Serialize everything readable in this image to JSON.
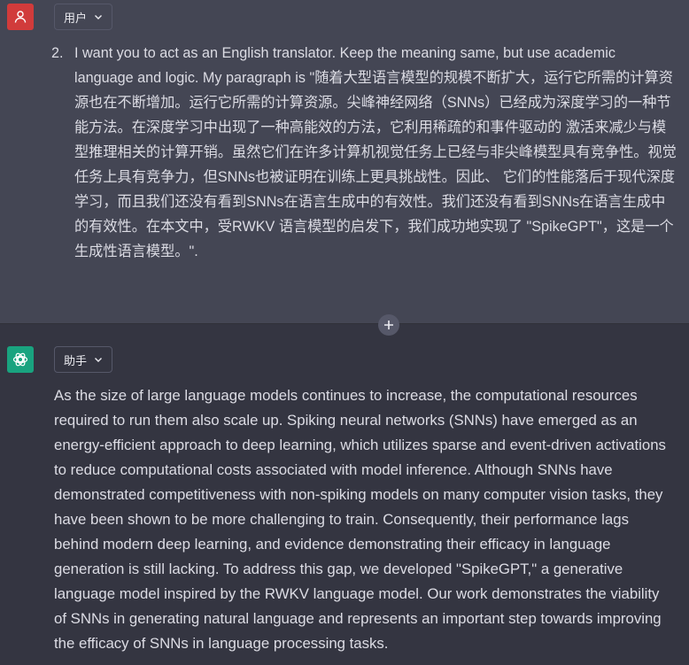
{
  "colors": {
    "user_bg": "#444654",
    "assistant_bg": "#343541",
    "user_avatar": "#d13b3b",
    "assistant_avatar": "#19a37f",
    "text": "#dcdce4"
  },
  "user": {
    "avatar_icon": "person-icon",
    "role_label": "用户",
    "dropdown_icon": "chevron-down-icon",
    "item_number": "2.",
    "message": "I want you to act as an English translator. Keep the meaning same, but use academic language and logic. My paragraph is \"随着大型语言模型的规模不断扩大，运行它所需的计算资源也在不断增加。运行它所需的计算资源。尖峰神经网络（SNNs）已经成为深度学习的一种节能方法。在深度学习中出现了一种高能效的方法，它利用稀疏的和事件驱动的 激活来减少与模型推理相关的计算开销。虽然它们在许多计算机视觉任务上已经与非尖峰模型具有竞争性。视觉任务上具有竞争力，但SNNs也被证明在训练上更具挑战性。因此、 它们的性能落后于现代深度学习，而且我们还没有看到SNNs在语言生成中的有效性。我们还没有看到SNNs在语言生成中的有效性。在本文中，受RWKV 语言模型的启发下，我们成功地实现了 \"SpikeGPT\"，这是一个生成性语言模型。\"."
  },
  "divider": {
    "plus_icon": "plus-icon"
  },
  "assistant": {
    "avatar_icon": "openai-logo-icon",
    "role_label": "助手",
    "dropdown_icon": "chevron-down-icon",
    "message": "As the size of large language models continues to increase, the computational resources required to run them also scale up. Spiking neural networks (SNNs) have emerged as an energy-efficient approach to deep learning, which utilizes sparse and event-driven activations to reduce computational costs associated with model inference. Although SNNs have demonstrated competitiveness with non-spiking models on many computer vision tasks, they have been shown to be more challenging to train. Consequently, their performance lags behind modern deep learning, and evidence demonstrating their efficacy in language generation is still lacking. To address this gap, we developed \"SpikeGPT,\" a generative language model inspired by the RWKV language model. Our work demonstrates the viability of SNNs in generating natural language and represents an important step towards improving the efficacy of SNNs in language processing tasks."
  }
}
